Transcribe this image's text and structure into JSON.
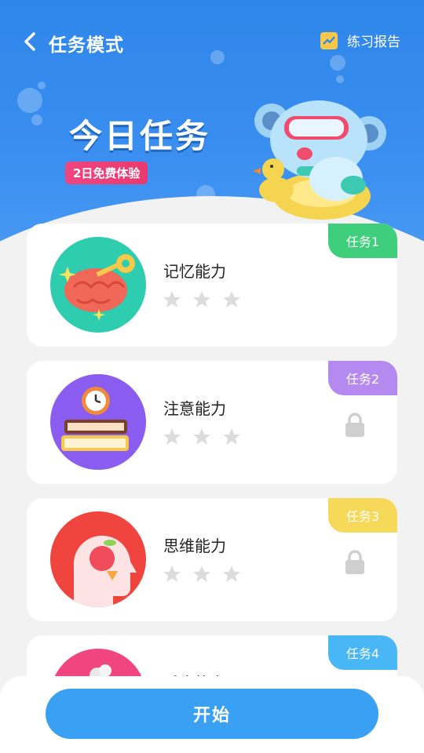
{
  "topbar": {
    "title": "任务模式",
    "report_label": "练习报告",
    "back_icon": "chevron-left-icon",
    "report_icon": "chart-icon"
  },
  "hero": {
    "title": "今日任务",
    "badge": "2日免费体验"
  },
  "tasks": [
    {
      "tag": "任务1",
      "name": "记忆能力",
      "tag_color": "#3fcf7c",
      "locked": false,
      "stars": 0,
      "icon": "brain-key-icon"
    },
    {
      "tag": "任务2",
      "name": "注意能力",
      "tag_color": "#b48af0",
      "locked": true,
      "stars": 0,
      "icon": "books-clock-icon"
    },
    {
      "tag": "任务3",
      "name": "思维能力",
      "tag_color": "#f7d95a",
      "locked": true,
      "stars": 0,
      "icon": "head-apple-icon"
    },
    {
      "tag": "任务4",
      "name": "反应能力",
      "tag_color": "#49b6f5",
      "locked": true,
      "stars": 0,
      "icon": "reaction-icon"
    }
  ],
  "start_button": "开始",
  "colors": {
    "header_blue": "#2f86ea",
    "start_button": "#3aa0f3",
    "badge_pink": "#e83a6e"
  }
}
